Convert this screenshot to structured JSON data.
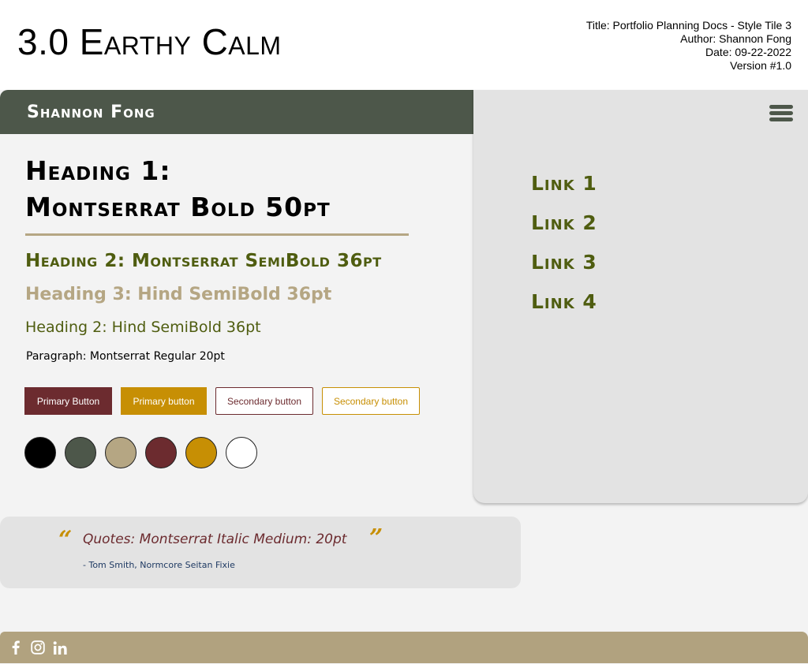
{
  "header": {
    "tile_title": "3.0 Earthy Calm",
    "meta": {
      "title": "Title: Portfolio Planning Docs - Style Tile 3",
      "author": "Author: Shannon Fong",
      "date": "Date: 09-22-2022",
      "version": "Version #1.0"
    }
  },
  "brand": {
    "name": "Shannon Fong"
  },
  "nav": {
    "menu_icon": "hamburger-menu-icon",
    "links": [
      "Link 1",
      "Link 2",
      "Link 3",
      "Link 4"
    ]
  },
  "typography": {
    "heading1_line1": "Heading 1:",
    "heading1_line2": "Montserrat Bold 50pt",
    "heading2": "Heading 2: Montserrat SemiBold 36pt",
    "heading3": "Heading 3: Hind SemiBold 36pt",
    "heading2_alt": "Heading 2: Hind SemiBold 36pt",
    "paragraph": "Paragraph: Montserrat Regular 20pt"
  },
  "buttons": {
    "primary_1": "Primary Button",
    "primary_2": "Primary button",
    "secondary_1": "Secondary button",
    "secondary_2": "Secondary button"
  },
  "palette": [
    "#000000",
    "#4d574a",
    "#b5a683",
    "#6c2b2f",
    "#c78f04",
    "#ffffff"
  ],
  "quote": {
    "open_mark": "“",
    "close_mark": "”",
    "text": "Quotes: Montserrat Italic Medium: 20pt",
    "author": "- Tom Smith, Normcore Seitan Fixie"
  },
  "footer": {
    "icons": [
      "facebook-icon",
      "instagram-icon",
      "linkedin-icon"
    ]
  },
  "colors": {
    "dark_green": "#4d574a",
    "olive": "#4f5d10",
    "tan": "#b5a683",
    "maroon": "#6c2b2f",
    "mustard": "#c78f04",
    "footer_tan": "#b1a27f"
  }
}
